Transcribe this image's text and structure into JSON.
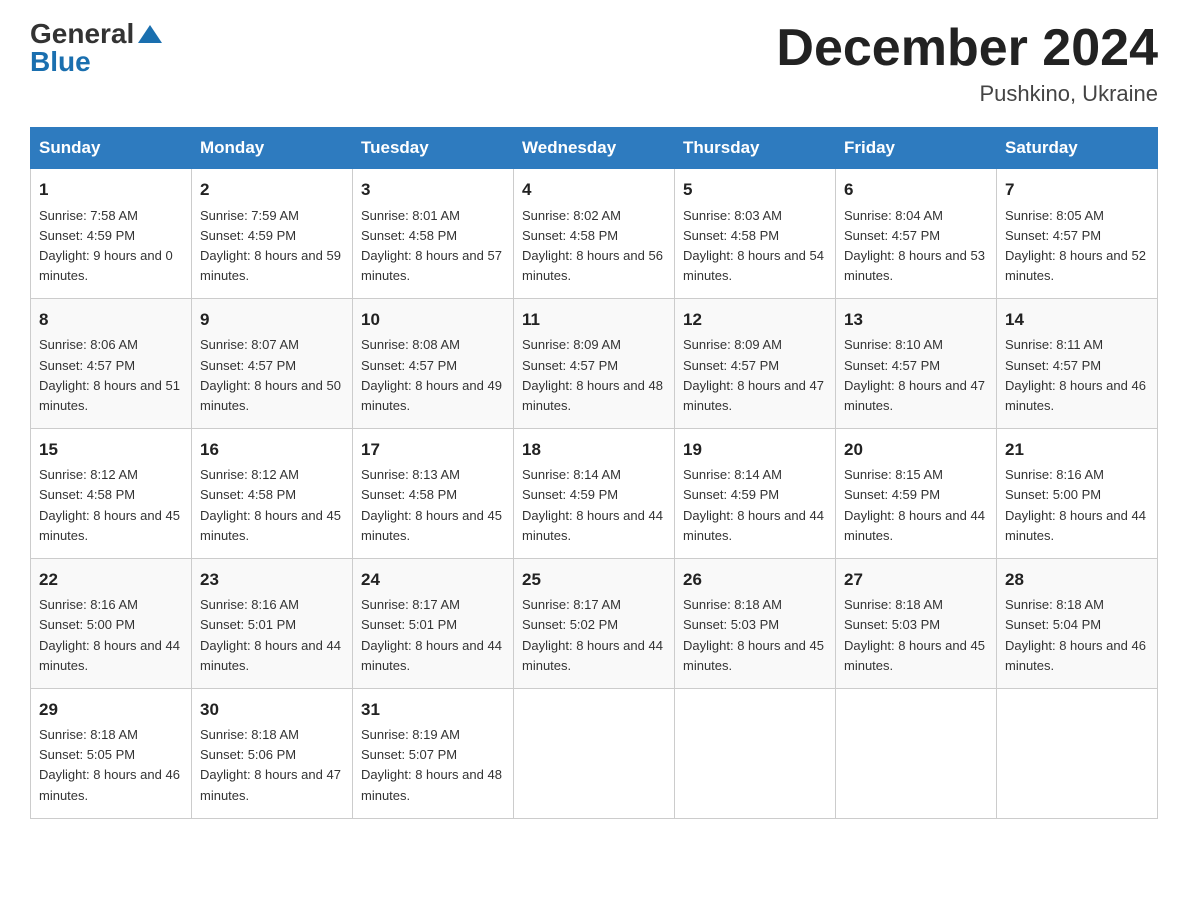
{
  "header": {
    "logo_general": "General",
    "logo_blue": "Blue",
    "month_title": "December 2024",
    "location": "Pushkino, Ukraine"
  },
  "days_of_week": [
    "Sunday",
    "Monday",
    "Tuesday",
    "Wednesday",
    "Thursday",
    "Friday",
    "Saturday"
  ],
  "weeks": [
    [
      {
        "day": "1",
        "sunrise": "7:58 AM",
        "sunset": "4:59 PM",
        "daylight": "9 hours and 0 minutes."
      },
      {
        "day": "2",
        "sunrise": "7:59 AM",
        "sunset": "4:59 PM",
        "daylight": "8 hours and 59 minutes."
      },
      {
        "day": "3",
        "sunrise": "8:01 AM",
        "sunset": "4:58 PM",
        "daylight": "8 hours and 57 minutes."
      },
      {
        "day": "4",
        "sunrise": "8:02 AM",
        "sunset": "4:58 PM",
        "daylight": "8 hours and 56 minutes."
      },
      {
        "day": "5",
        "sunrise": "8:03 AM",
        "sunset": "4:58 PM",
        "daylight": "8 hours and 54 minutes."
      },
      {
        "day": "6",
        "sunrise": "8:04 AM",
        "sunset": "4:57 PM",
        "daylight": "8 hours and 53 minutes."
      },
      {
        "day": "7",
        "sunrise": "8:05 AM",
        "sunset": "4:57 PM",
        "daylight": "8 hours and 52 minutes."
      }
    ],
    [
      {
        "day": "8",
        "sunrise": "8:06 AM",
        "sunset": "4:57 PM",
        "daylight": "8 hours and 51 minutes."
      },
      {
        "day": "9",
        "sunrise": "8:07 AM",
        "sunset": "4:57 PM",
        "daylight": "8 hours and 50 minutes."
      },
      {
        "day": "10",
        "sunrise": "8:08 AM",
        "sunset": "4:57 PM",
        "daylight": "8 hours and 49 minutes."
      },
      {
        "day": "11",
        "sunrise": "8:09 AM",
        "sunset": "4:57 PM",
        "daylight": "8 hours and 48 minutes."
      },
      {
        "day": "12",
        "sunrise": "8:09 AM",
        "sunset": "4:57 PM",
        "daylight": "8 hours and 47 minutes."
      },
      {
        "day": "13",
        "sunrise": "8:10 AM",
        "sunset": "4:57 PM",
        "daylight": "8 hours and 47 minutes."
      },
      {
        "day": "14",
        "sunrise": "8:11 AM",
        "sunset": "4:57 PM",
        "daylight": "8 hours and 46 minutes."
      }
    ],
    [
      {
        "day": "15",
        "sunrise": "8:12 AM",
        "sunset": "4:58 PM",
        "daylight": "8 hours and 45 minutes."
      },
      {
        "day": "16",
        "sunrise": "8:12 AM",
        "sunset": "4:58 PM",
        "daylight": "8 hours and 45 minutes."
      },
      {
        "day": "17",
        "sunrise": "8:13 AM",
        "sunset": "4:58 PM",
        "daylight": "8 hours and 45 minutes."
      },
      {
        "day": "18",
        "sunrise": "8:14 AM",
        "sunset": "4:59 PM",
        "daylight": "8 hours and 44 minutes."
      },
      {
        "day": "19",
        "sunrise": "8:14 AM",
        "sunset": "4:59 PM",
        "daylight": "8 hours and 44 minutes."
      },
      {
        "day": "20",
        "sunrise": "8:15 AM",
        "sunset": "4:59 PM",
        "daylight": "8 hours and 44 minutes."
      },
      {
        "day": "21",
        "sunrise": "8:16 AM",
        "sunset": "5:00 PM",
        "daylight": "8 hours and 44 minutes."
      }
    ],
    [
      {
        "day": "22",
        "sunrise": "8:16 AM",
        "sunset": "5:00 PM",
        "daylight": "8 hours and 44 minutes."
      },
      {
        "day": "23",
        "sunrise": "8:16 AM",
        "sunset": "5:01 PM",
        "daylight": "8 hours and 44 minutes."
      },
      {
        "day": "24",
        "sunrise": "8:17 AM",
        "sunset": "5:01 PM",
        "daylight": "8 hours and 44 minutes."
      },
      {
        "day": "25",
        "sunrise": "8:17 AM",
        "sunset": "5:02 PM",
        "daylight": "8 hours and 44 minutes."
      },
      {
        "day": "26",
        "sunrise": "8:18 AM",
        "sunset": "5:03 PM",
        "daylight": "8 hours and 45 minutes."
      },
      {
        "day": "27",
        "sunrise": "8:18 AM",
        "sunset": "5:03 PM",
        "daylight": "8 hours and 45 minutes."
      },
      {
        "day": "28",
        "sunrise": "8:18 AM",
        "sunset": "5:04 PM",
        "daylight": "8 hours and 46 minutes."
      }
    ],
    [
      {
        "day": "29",
        "sunrise": "8:18 AM",
        "sunset": "5:05 PM",
        "daylight": "8 hours and 46 minutes."
      },
      {
        "day": "30",
        "sunrise": "8:18 AM",
        "sunset": "5:06 PM",
        "daylight": "8 hours and 47 minutes."
      },
      {
        "day": "31",
        "sunrise": "8:19 AM",
        "sunset": "5:07 PM",
        "daylight": "8 hours and 48 minutes."
      },
      null,
      null,
      null,
      null
    ]
  ]
}
